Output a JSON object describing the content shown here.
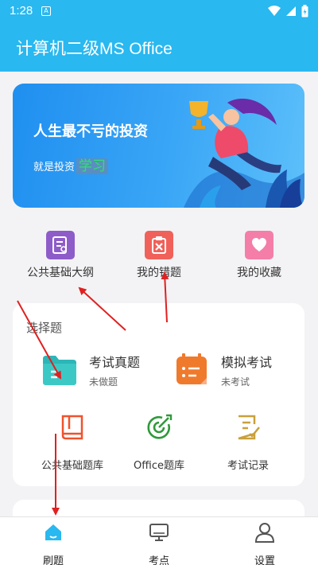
{
  "status_bar": {
    "time": "1:28",
    "notification_glyph": "A"
  },
  "app_bar": {
    "title": "计算机二级MS Office"
  },
  "banner": {
    "headline": "人生最不亏的投资",
    "subline": "就是投资",
    "highlight": "学习"
  },
  "quick_actions": [
    {
      "label": "公共基础大纲",
      "icon": "syllabus-icon",
      "color": "#8e5cc9"
    },
    {
      "label": "我的错题",
      "icon": "wrong-questions-icon",
      "color": "#f0615a"
    },
    {
      "label": "我的收藏",
      "icon": "favorites-icon",
      "color": "#f47ea8"
    }
  ],
  "choice_section": {
    "title": "选择题",
    "exam": {
      "title": "考试真题",
      "subtitle": "未做题"
    },
    "mock": {
      "title": "模拟考试",
      "subtitle": "未考试"
    },
    "tools": [
      {
        "label": "公共基础题库",
        "icon": "book-icon",
        "color": "#f0522c"
      },
      {
        "label": "Office题库",
        "icon": "target-icon",
        "color": "#2e9a3a"
      },
      {
        "label": "考试记录",
        "icon": "record-icon",
        "color": "#c9a03a"
      }
    ]
  },
  "bottom_nav": [
    {
      "label": "刷题",
      "icon": "home-icon",
      "active": true
    },
    {
      "label": "考点",
      "icon": "monitor-icon",
      "active": false
    },
    {
      "label": "设置",
      "icon": "user-icon",
      "active": false
    }
  ],
  "colors": {
    "primary": "#29b8f0",
    "active_tab": "#29b8f0",
    "annotation_arrow": "#e02020"
  }
}
